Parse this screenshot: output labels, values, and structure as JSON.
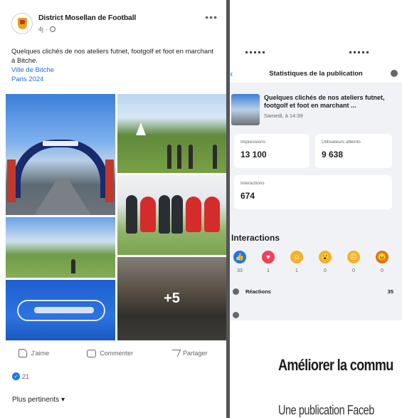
{
  "post": {
    "page_name": "District Mosellan de Football",
    "time": "4j",
    "text": "Quelques clichés de nos ateliers futnet, footgolf et foot en marchant à Bitche.",
    "links": [
      "Ville de Bitche",
      "Paris 2024"
    ],
    "more_photos": "+5",
    "actions": {
      "like": "J'aime",
      "comment": "Commenter",
      "share": "Partager"
    },
    "likes_count": "21",
    "sort_label": "Plus pertinents"
  },
  "stats": {
    "title": "Statistiques de la publication",
    "publication_text": "Quelques clichés de nos ateliers futnet, footgolf et foot en marchant ...",
    "publication_date": "Samedi, à 14:39",
    "impressions_label": "Impressions",
    "impressions_value": "13 100",
    "users_label": "Utilisateurs atteints",
    "users_value": "9 638",
    "interactions_label": "Interactions",
    "interactions_value": "674",
    "interactions_heading": "Interactions",
    "reactions": [
      {
        "name": "like-reaction",
        "count": "33",
        "color": "#1877f2",
        "glyph": "👍"
      },
      {
        "name": "love-reaction",
        "count": "1",
        "color": "#f33e58",
        "glyph": "♥"
      },
      {
        "name": "haha-reaction",
        "count": "1",
        "color": "#f7b125",
        "glyph": "☺"
      },
      {
        "name": "wow-reaction",
        "count": "0",
        "color": "#f7b125",
        "glyph": "😮"
      },
      {
        "name": "sad-reaction",
        "count": "0",
        "color": "#f7b125",
        "glyph": "☹"
      },
      {
        "name": "angry-reaction",
        "count": "0",
        "color": "#e9710f",
        "glyph": "😠"
      }
    ],
    "reactions_row_label": "Réactions",
    "reactions_row_count": "35"
  },
  "article": {
    "title": "Améliorer la commu",
    "subtitle": "Une publication Faceb"
  }
}
